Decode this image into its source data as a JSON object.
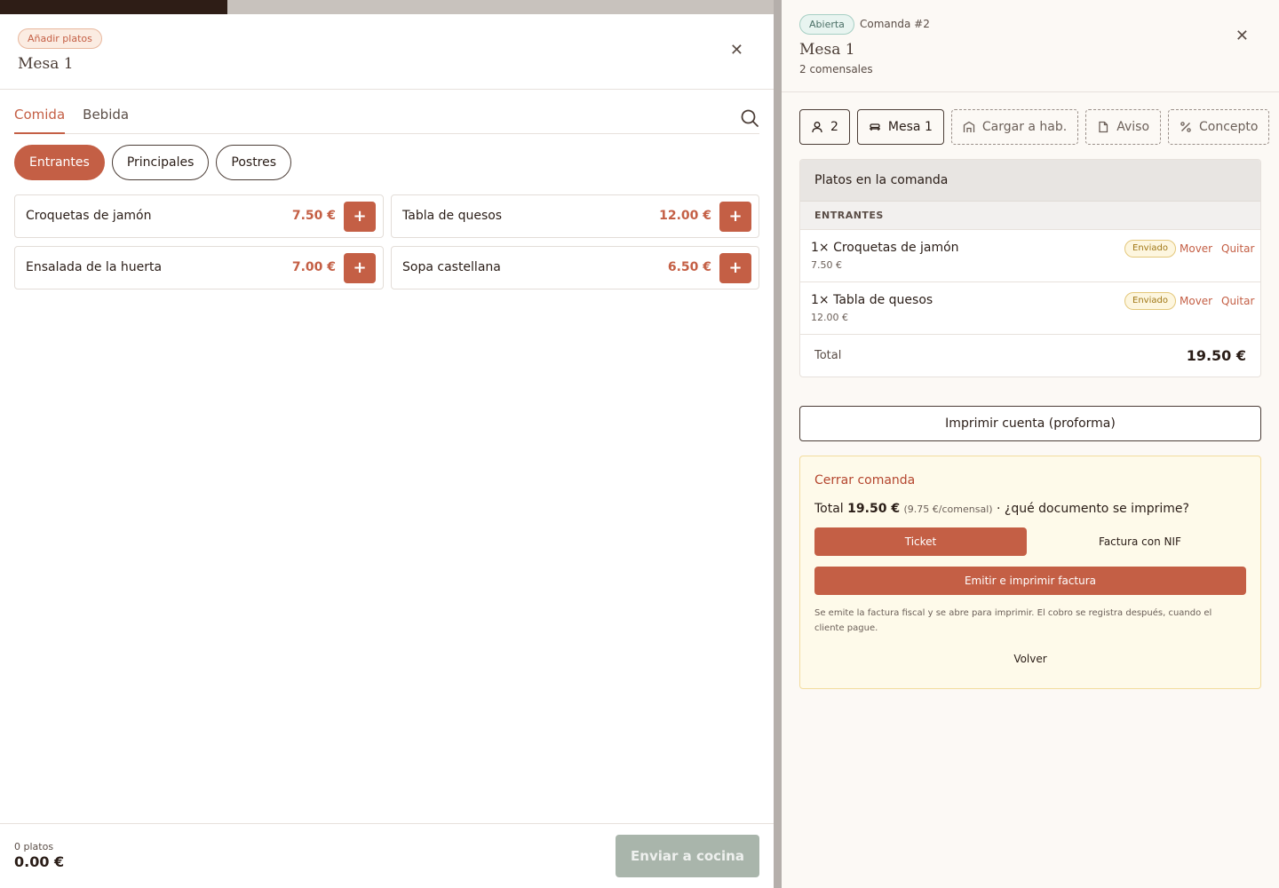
{
  "colors": {
    "accent": "#c45f45",
    "sent_badge": "#a07715",
    "open_badge": "#4b6f66",
    "send_disabled": "#a9b5ab"
  },
  "add_panel": {
    "badge": "Añadir platos",
    "title": "Mesa 1",
    "tabs": [
      {
        "label": "Comida",
        "active": true
      },
      {
        "label": "Bebida",
        "active": false
      }
    ],
    "categories": [
      {
        "label": "Entrantes",
        "active": true
      },
      {
        "label": "Principales",
        "active": false
      },
      {
        "label": "Postres",
        "active": false
      }
    ],
    "dishes": [
      {
        "name": "Croquetas de jamón",
        "price": "7.50 €"
      },
      {
        "name": "Tabla de quesos",
        "price": "12.00 €"
      },
      {
        "name": "Ensalada de la huerta",
        "price": "7.00 €"
      },
      {
        "name": "Sopa castellana",
        "price": "6.50 €"
      }
    ],
    "add_symbol": "+",
    "footer": {
      "count": "0 platos",
      "total": "0.00 €",
      "send_label": "Enviar a cocina"
    }
  },
  "order_panel": {
    "status": "Abierta",
    "order_number": "Comanda #2",
    "title": "Mesa 1",
    "diners": "2 comensales",
    "chips": [
      {
        "icon": "person-icon",
        "label": "2"
      },
      {
        "icon": "table-icon",
        "label": "Mesa 1"
      },
      {
        "icon": "building-icon",
        "label": "Cargar a hab."
      },
      {
        "icon": "document-icon",
        "label": "Aviso"
      },
      {
        "icon": "percent-icon",
        "label": "Concepto"
      }
    ],
    "items_header": "Platos en la comanda",
    "section_label": "ENTRANTES",
    "lines": [
      {
        "name": "1× Croquetas de jamón",
        "price": "7.50 €",
        "badge": "Enviado",
        "move": "Mover",
        "remove": "Quitar"
      },
      {
        "name": "1× Tabla de quesos",
        "price": "12.00 €",
        "badge": "Enviado",
        "move": "Mover",
        "remove": "Quitar"
      }
    ],
    "total_label": "Total",
    "total_value": "19.50 €",
    "print_label": "Imprimir cuenta (proforma)",
    "close": {
      "title": "Cerrar comanda",
      "total_prefix": "Total",
      "total_value": "19.50 €",
      "per_diner": "(9.75 €/comensal)",
      "question": "· ¿qué documento se imprime?",
      "doc_ticket": "Ticket",
      "doc_nif": "Factura con NIF",
      "emit_label": "Emitir e imprimir factura",
      "note": "Se emite la factura fiscal y se abre para imprimir. El cobro se registra después, cuando el cliente pague.",
      "back_label": "Volver"
    }
  }
}
